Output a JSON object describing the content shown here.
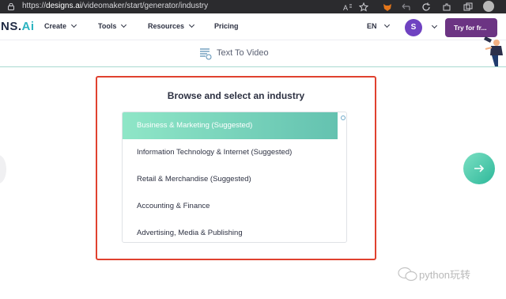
{
  "browser": {
    "url_domain": "designs.ai",
    "url_path": "/videomaker/start/generator/industry",
    "url_prefix": "https://"
  },
  "nav": {
    "logo_main": "NS.",
    "logo_accent": "Ai",
    "items": [
      {
        "label": "Create"
      },
      {
        "label": "Tools"
      },
      {
        "label": "Resources"
      },
      {
        "label": "Pricing"
      }
    ],
    "language": "EN",
    "avatar_initial": "S",
    "cta_label": "Try for fr..."
  },
  "toolbar": {
    "mode_label": "Text To Video",
    "mode_icon": "text-lines-icon"
  },
  "picker": {
    "title": "Browse and select an industry",
    "items": [
      {
        "label": "Business & Marketing (Suggested)",
        "selected": true
      },
      {
        "label": "Information Technology & Internet (Suggested)",
        "selected": false
      },
      {
        "label": "Retail & Merchandise (Suggested)",
        "selected": false
      },
      {
        "label": "Accounting & Finance",
        "selected": false
      },
      {
        "label": "Advertising, Media & Publishing",
        "selected": false
      }
    ]
  },
  "colors": {
    "accent": "#6c3483",
    "avatar": "#6f42c1",
    "selected_start": "#8fe6c7",
    "selected_end": "#64c2b0",
    "highlight_border": "#e0412f"
  },
  "watermark": {
    "text": "python玩转"
  }
}
